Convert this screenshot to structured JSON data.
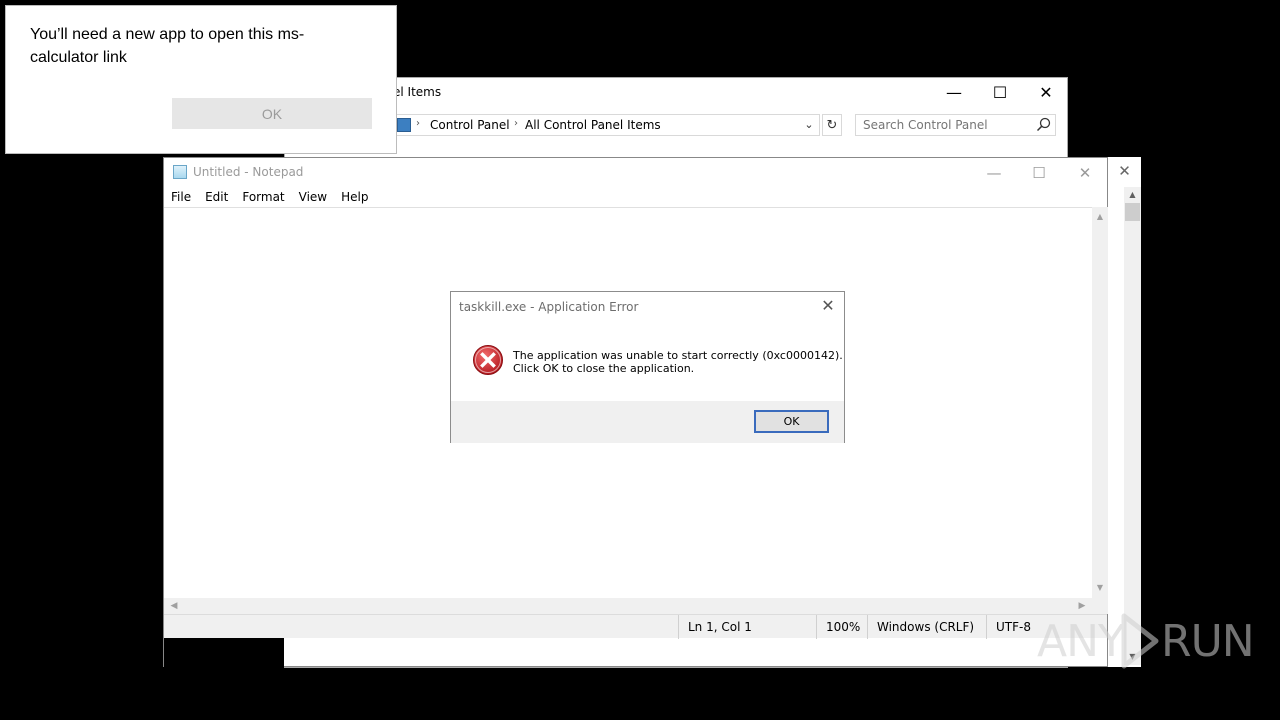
{
  "toast": {
    "message": "You’ll need a new app to open this ms-calculator link",
    "ok_label": "OK"
  },
  "control_panel": {
    "title_partial": "el Items",
    "breadcrumb": [
      "Control Panel",
      "All Control Panel Items"
    ],
    "search_placeholder": "Search Control Panel",
    "buttons": {
      "minimize": "—",
      "maximize": "☐",
      "close": "✕"
    }
  },
  "back_window": {
    "close_glyph": "✕"
  },
  "notepad": {
    "title": "Untitled - Notepad",
    "menu": [
      "File",
      "Edit",
      "Format",
      "View",
      "Help"
    ],
    "status": {
      "position": "Ln 1, Col 1",
      "zoom": "100%",
      "line_ending": "Windows (CRLF)",
      "encoding": "UTF-8"
    }
  },
  "error_dialog": {
    "title": "taskkill.exe - Application Error",
    "message_line1": "The application was unable to start correctly (0xc0000142).",
    "message_line2": "Click OK to close the application.",
    "ok_label": "OK",
    "icon": "error-icon"
  },
  "watermark": {
    "left_text": "ANY",
    "right_text": "RUN"
  },
  "colors": {
    "desktop": "#000000",
    "error_red": "#d2232a",
    "default_button_border": "#3a6bbd"
  }
}
